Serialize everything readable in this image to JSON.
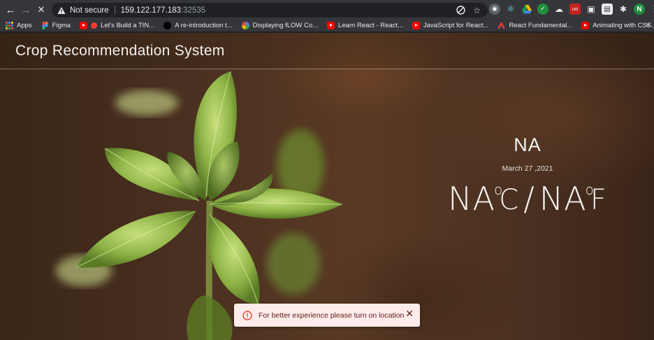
{
  "browser": {
    "omnibox": {
      "security_label": "Not secure",
      "host": "159.122.177.183",
      "port": ":32535"
    },
    "profile_initial": "N",
    "bookmarks": [
      {
        "label": "Apps",
        "icon": "apps-grid-icon"
      },
      {
        "label": "Figma",
        "icon": "figma-icon"
      },
      {
        "label": "Let's Build a TIN...",
        "icon": "youtube-icon"
      },
      {
        "label": "A re-introduction t...",
        "icon": "mdn-icon"
      },
      {
        "label": "Displaying fLOW Co...",
        "icon": "pinwheel-icon"
      },
      {
        "label": "Learn React - React...",
        "icon": "youtube-icon"
      },
      {
        "label": "JavaScript for React...",
        "icon": "youtube-icon"
      },
      {
        "label": "React Fundamental...",
        "icon": "adobe-icon"
      },
      {
        "label": "Animating with CSS...",
        "icon": "youtube-icon"
      }
    ],
    "bookmarks_overflow": "»"
  },
  "app": {
    "title": "Crop Recommendation System",
    "weather": {
      "city": "NA",
      "date": "March 27 ,2021",
      "temp_c": "NA",
      "unit_c": "C",
      "separator": "/",
      "temp_f": "NA",
      "unit_f": "F",
      "degree_symbol": "o"
    },
    "toast": {
      "message": "For better experience please turn on location",
      "close_symbol": "✕",
      "color": "#fdecea"
    }
  }
}
